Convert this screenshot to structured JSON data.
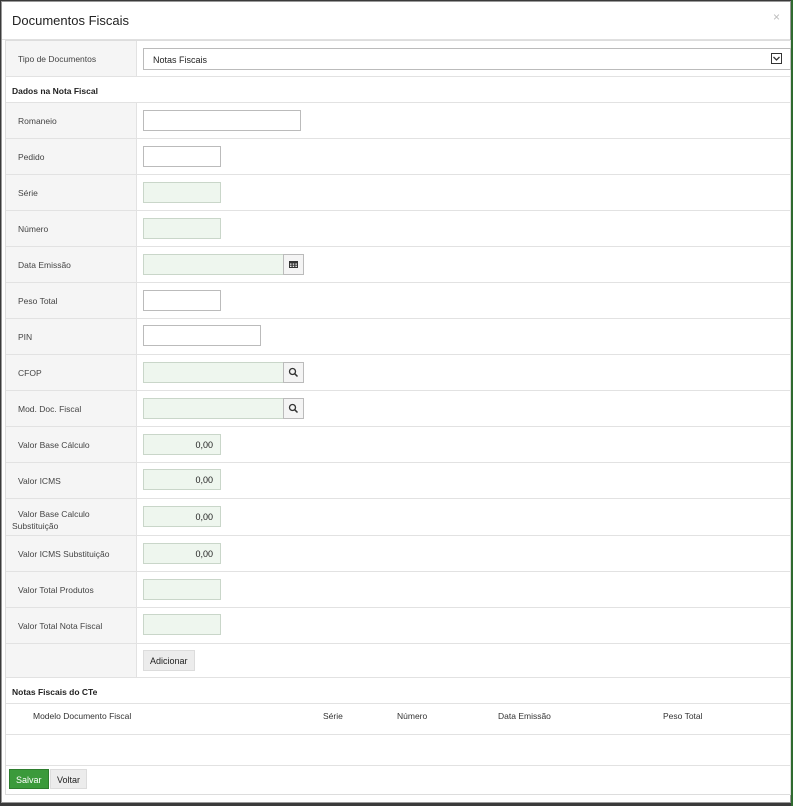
{
  "dialog": {
    "title": "Documentos Fiscais",
    "close_icon": "×"
  },
  "tipo": {
    "label": "Tipo de Documentos",
    "value": "Notas Fiscais"
  },
  "sections": {
    "dados_title": "Dados na Nota Fiscal",
    "notas_title": "Notas Fiscais do CTe"
  },
  "fields": {
    "romaneio": {
      "label": "Romaneio",
      "value": ""
    },
    "pedido": {
      "label": "Pedido",
      "value": ""
    },
    "serie": {
      "label": "Série",
      "value": ""
    },
    "numero": {
      "label": "Número",
      "value": ""
    },
    "data_emissao": {
      "label": "Data Emissão",
      "value": ""
    },
    "peso_total": {
      "label": "Peso Total",
      "value": ""
    },
    "pin": {
      "label": "PIN",
      "value": ""
    },
    "cfop": {
      "label": "CFOP",
      "value": ""
    },
    "mod_doc": {
      "label": "Mod. Doc. Fiscal",
      "value": ""
    },
    "valor_base_calculo": {
      "label": "Valor Base Cálculo",
      "value": "0,00"
    },
    "valor_icms": {
      "label": "Valor ICMS",
      "value": "0,00"
    },
    "valor_base_subst": {
      "label": "Valor Base Calculo Substituição",
      "value": "0,00"
    },
    "valor_icms_subst": {
      "label": "Valor ICMS Substituição",
      "value": "0,00"
    },
    "valor_total_produtos": {
      "label": "Valor Total Produtos",
      "value": ""
    },
    "valor_total_nota": {
      "label": "Valor Total Nota Fiscal",
      "value": ""
    }
  },
  "buttons": {
    "adicionar": "Adicionar",
    "salvar": "Salvar",
    "voltar": "Voltar"
  },
  "table": {
    "columns": [
      "Modelo Documento Fiscal",
      "Série",
      "Número",
      "Data Emissão",
      "Peso Total"
    ]
  },
  "icons": {
    "calendar": "calendar-icon",
    "search": "search-icon",
    "dropdown": "chevron-down-icon"
  },
  "colors": {
    "save_button": "#3b9a3b",
    "readonly_input": "#eef6ee"
  }
}
